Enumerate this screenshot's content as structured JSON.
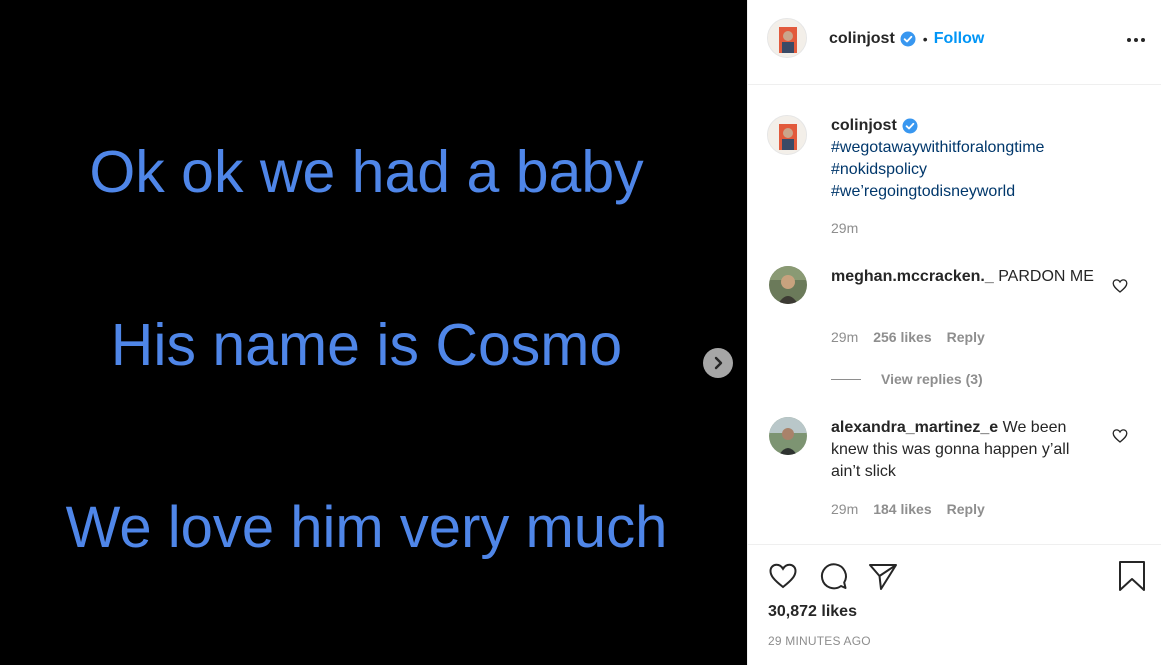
{
  "media": {
    "lines": [
      "Ok ok we had a baby",
      "His name is Cosmo",
      "We love him very much"
    ],
    "text_color": "#4f86e8"
  },
  "header": {
    "username": "colinjost",
    "separator": "•",
    "follow_label": "Follow",
    "more_icon": "more-options-icon"
  },
  "caption": {
    "username": "colinjost",
    "hashtags": [
      "#wegotawaywithitforalongtime",
      "#nokidspolicy",
      "#we’regoingtodisneyworld"
    ],
    "time": "29m"
  },
  "comments": [
    {
      "username": "meghan.mccracken._",
      "text": " PARDON ME",
      "time": "29m",
      "likes": "256 likes",
      "reply_label": "Reply",
      "view_replies": "View replies (3)"
    },
    {
      "username": "alexandra_martinez_e",
      "text": " We been knew this was gonna happen y’all ain’t slick",
      "time": "29m",
      "likes": "184 likes",
      "reply_label": "Reply"
    }
  ],
  "footer": {
    "likes": "30,872 likes",
    "posted": "29 MINUTES AGO"
  },
  "colors": {
    "link_blue": "#0095f6",
    "hashtag_blue": "#00376b",
    "muted": "#8e8e8e",
    "verified_blue": "#3897f0"
  }
}
